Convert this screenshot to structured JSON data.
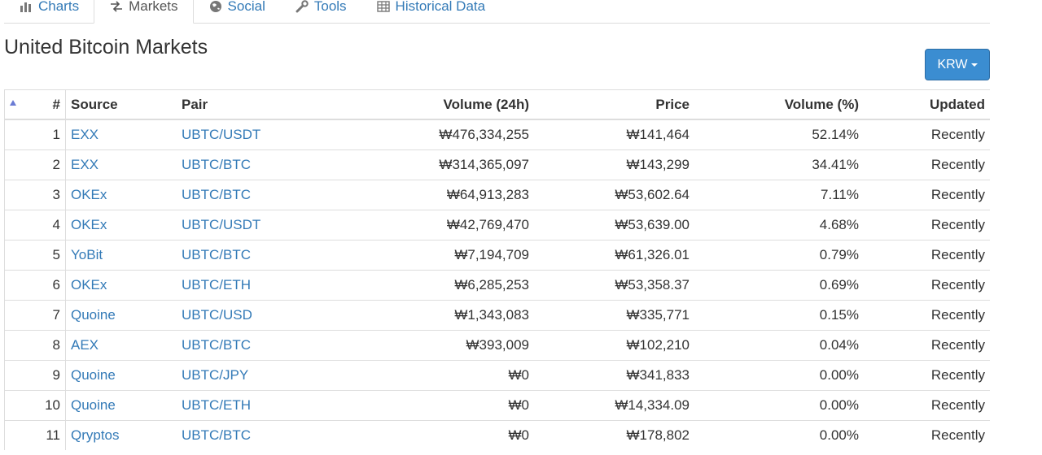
{
  "tabs": [
    {
      "label": "Charts",
      "icon": "bar-chart-icon",
      "active": false
    },
    {
      "label": "Markets",
      "icon": "exchange-arrows-icon",
      "active": true
    },
    {
      "label": "Social",
      "icon": "globe-icon",
      "active": false
    },
    {
      "label": "Tools",
      "icon": "wrench-icon",
      "active": false
    },
    {
      "label": "Historical Data",
      "icon": "table-grid-icon",
      "active": false
    }
  ],
  "page_title": "United Bitcoin Markets",
  "currency_button": {
    "label": "KRW"
  },
  "table": {
    "headers": {
      "num": "#",
      "source": "Source",
      "pair": "Pair",
      "volume": "Volume (24h)",
      "price": "Price",
      "volume_pct": "Volume (%)",
      "updated": "Updated"
    },
    "rows": [
      {
        "num": "1",
        "source": "EXX",
        "pair": "UBTC/USDT",
        "volume": "₩476,334,255",
        "price": "₩141,464",
        "volume_pct": "52.14%",
        "updated": "Recently"
      },
      {
        "num": "2",
        "source": "EXX",
        "pair": "UBTC/BTC",
        "volume": "₩314,365,097",
        "price": "₩143,299",
        "volume_pct": "34.41%",
        "updated": "Recently"
      },
      {
        "num": "3",
        "source": "OKEx",
        "pair": "UBTC/BTC",
        "volume": "₩64,913,283",
        "price": "₩53,602.64",
        "volume_pct": "7.11%",
        "updated": "Recently"
      },
      {
        "num": "4",
        "source": "OKEx",
        "pair": "UBTC/USDT",
        "volume": "₩42,769,470",
        "price": "₩53,639.00",
        "volume_pct": "4.68%",
        "updated": "Recently"
      },
      {
        "num": "5",
        "source": "YoBit",
        "pair": "UBTC/BTC",
        "volume": "₩7,194,709",
        "price": "₩61,326.01",
        "volume_pct": "0.79%",
        "updated": "Recently"
      },
      {
        "num": "6",
        "source": "OKEx",
        "pair": "UBTC/ETH",
        "volume": "₩6,285,253",
        "price": "₩53,358.37",
        "volume_pct": "0.69%",
        "updated": "Recently"
      },
      {
        "num": "7",
        "source": "Quoine",
        "pair": "UBTC/USD",
        "volume": "₩1,343,083",
        "price": "₩335,771",
        "volume_pct": "0.15%",
        "updated": "Recently"
      },
      {
        "num": "8",
        "source": "AEX",
        "pair": "UBTC/BTC",
        "volume": "₩393,009",
        "price": "₩102,210",
        "volume_pct": "0.04%",
        "updated": "Recently"
      },
      {
        "num": "9",
        "source": "Quoine",
        "pair": "UBTC/JPY",
        "volume": "₩0",
        "price": "₩341,833",
        "volume_pct": "0.00%",
        "updated": "Recently"
      },
      {
        "num": "10",
        "source": "Quoine",
        "pair": "UBTC/ETH",
        "volume": "₩0",
        "price": "₩14,334.09",
        "volume_pct": "0.00%",
        "updated": "Recently"
      },
      {
        "num": "11",
        "source": "Qryptos",
        "pair": "UBTC/BTC",
        "volume": "₩0",
        "price": "₩178,802",
        "volume_pct": "0.00%",
        "updated": "Recently"
      }
    ]
  },
  "colors": {
    "link": "#337ab7",
    "button": "#3b8dd1",
    "border": "#dddddd",
    "sort_arrow": "#6a7bd4"
  }
}
